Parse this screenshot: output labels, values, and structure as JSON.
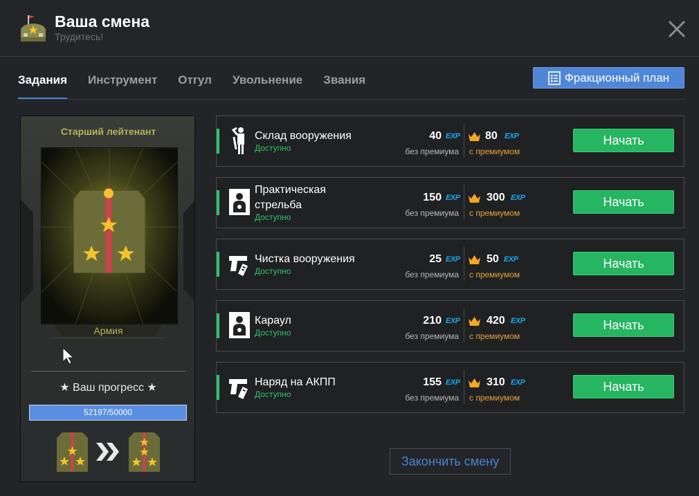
{
  "header": {
    "title": "Ваша смена",
    "subtitle": "Трудитесь!",
    "logo_icon": "army-base-icon",
    "close_icon": "close-icon"
  },
  "tabs": [
    {
      "label": "Задания",
      "active": true
    },
    {
      "label": "Инструмент",
      "active": false
    },
    {
      "label": "Отгул",
      "active": false
    },
    {
      "label": "Увольнение",
      "active": false
    },
    {
      "label": "Звания",
      "active": false
    }
  ],
  "plan_button": {
    "label": "Фракционный план",
    "icon": "checklist-icon"
  },
  "rank": {
    "name": "Старший лейтенант",
    "faction": "Армия",
    "progress_label": "★ Ваш прогресс ★",
    "progress_text": "52197/50000",
    "progress_fraction": 1.0
  },
  "tasks": [
    {
      "name": "Склад вооружения",
      "status": "Доступно",
      "icon": "soldier-salute-icon",
      "base_exp": "40",
      "prem_exp": "80",
      "exp_tag": "EXP",
      "base_note": "без премиума",
      "prem_note": "с премиумом",
      "button": "Начать"
    },
    {
      "name": "Практическая стрельба",
      "status": "Доступно",
      "icon": "shooting-target-icon",
      "base_exp": "150",
      "prem_exp": "300",
      "exp_tag": "EXP",
      "base_note": "без премиума",
      "prem_note": "с премиумом",
      "button": "Начать"
    },
    {
      "name": "Чистка вооружения",
      "status": "Доступно",
      "icon": "pistol-cleaning-icon",
      "base_exp": "25",
      "prem_exp": "50",
      "exp_tag": "EXP",
      "base_note": "без премиума",
      "prem_note": "с премиумом",
      "button": "Начать"
    },
    {
      "name": "Караул",
      "status": "Доступно",
      "icon": "guard-target-icon",
      "base_exp": "210",
      "prem_exp": "420",
      "exp_tag": "EXP",
      "base_note": "без премиума",
      "prem_note": "с премиумом",
      "button": "Начать"
    },
    {
      "name": "Наряд на АКПП",
      "status": "Доступно",
      "icon": "pistol-icon",
      "base_exp": "155",
      "prem_exp": "310",
      "exp_tag": "EXP",
      "base_note": "без премиума",
      "prem_note": "с премиумом",
      "button": "Начать"
    }
  ],
  "finish_button": "Закончить смену",
  "colors": {
    "accent_green": "#26b561",
    "accent_blue": "#4f86d8",
    "exp_blue": "#1aa8ec",
    "premium_orange": "#e8a33a"
  }
}
